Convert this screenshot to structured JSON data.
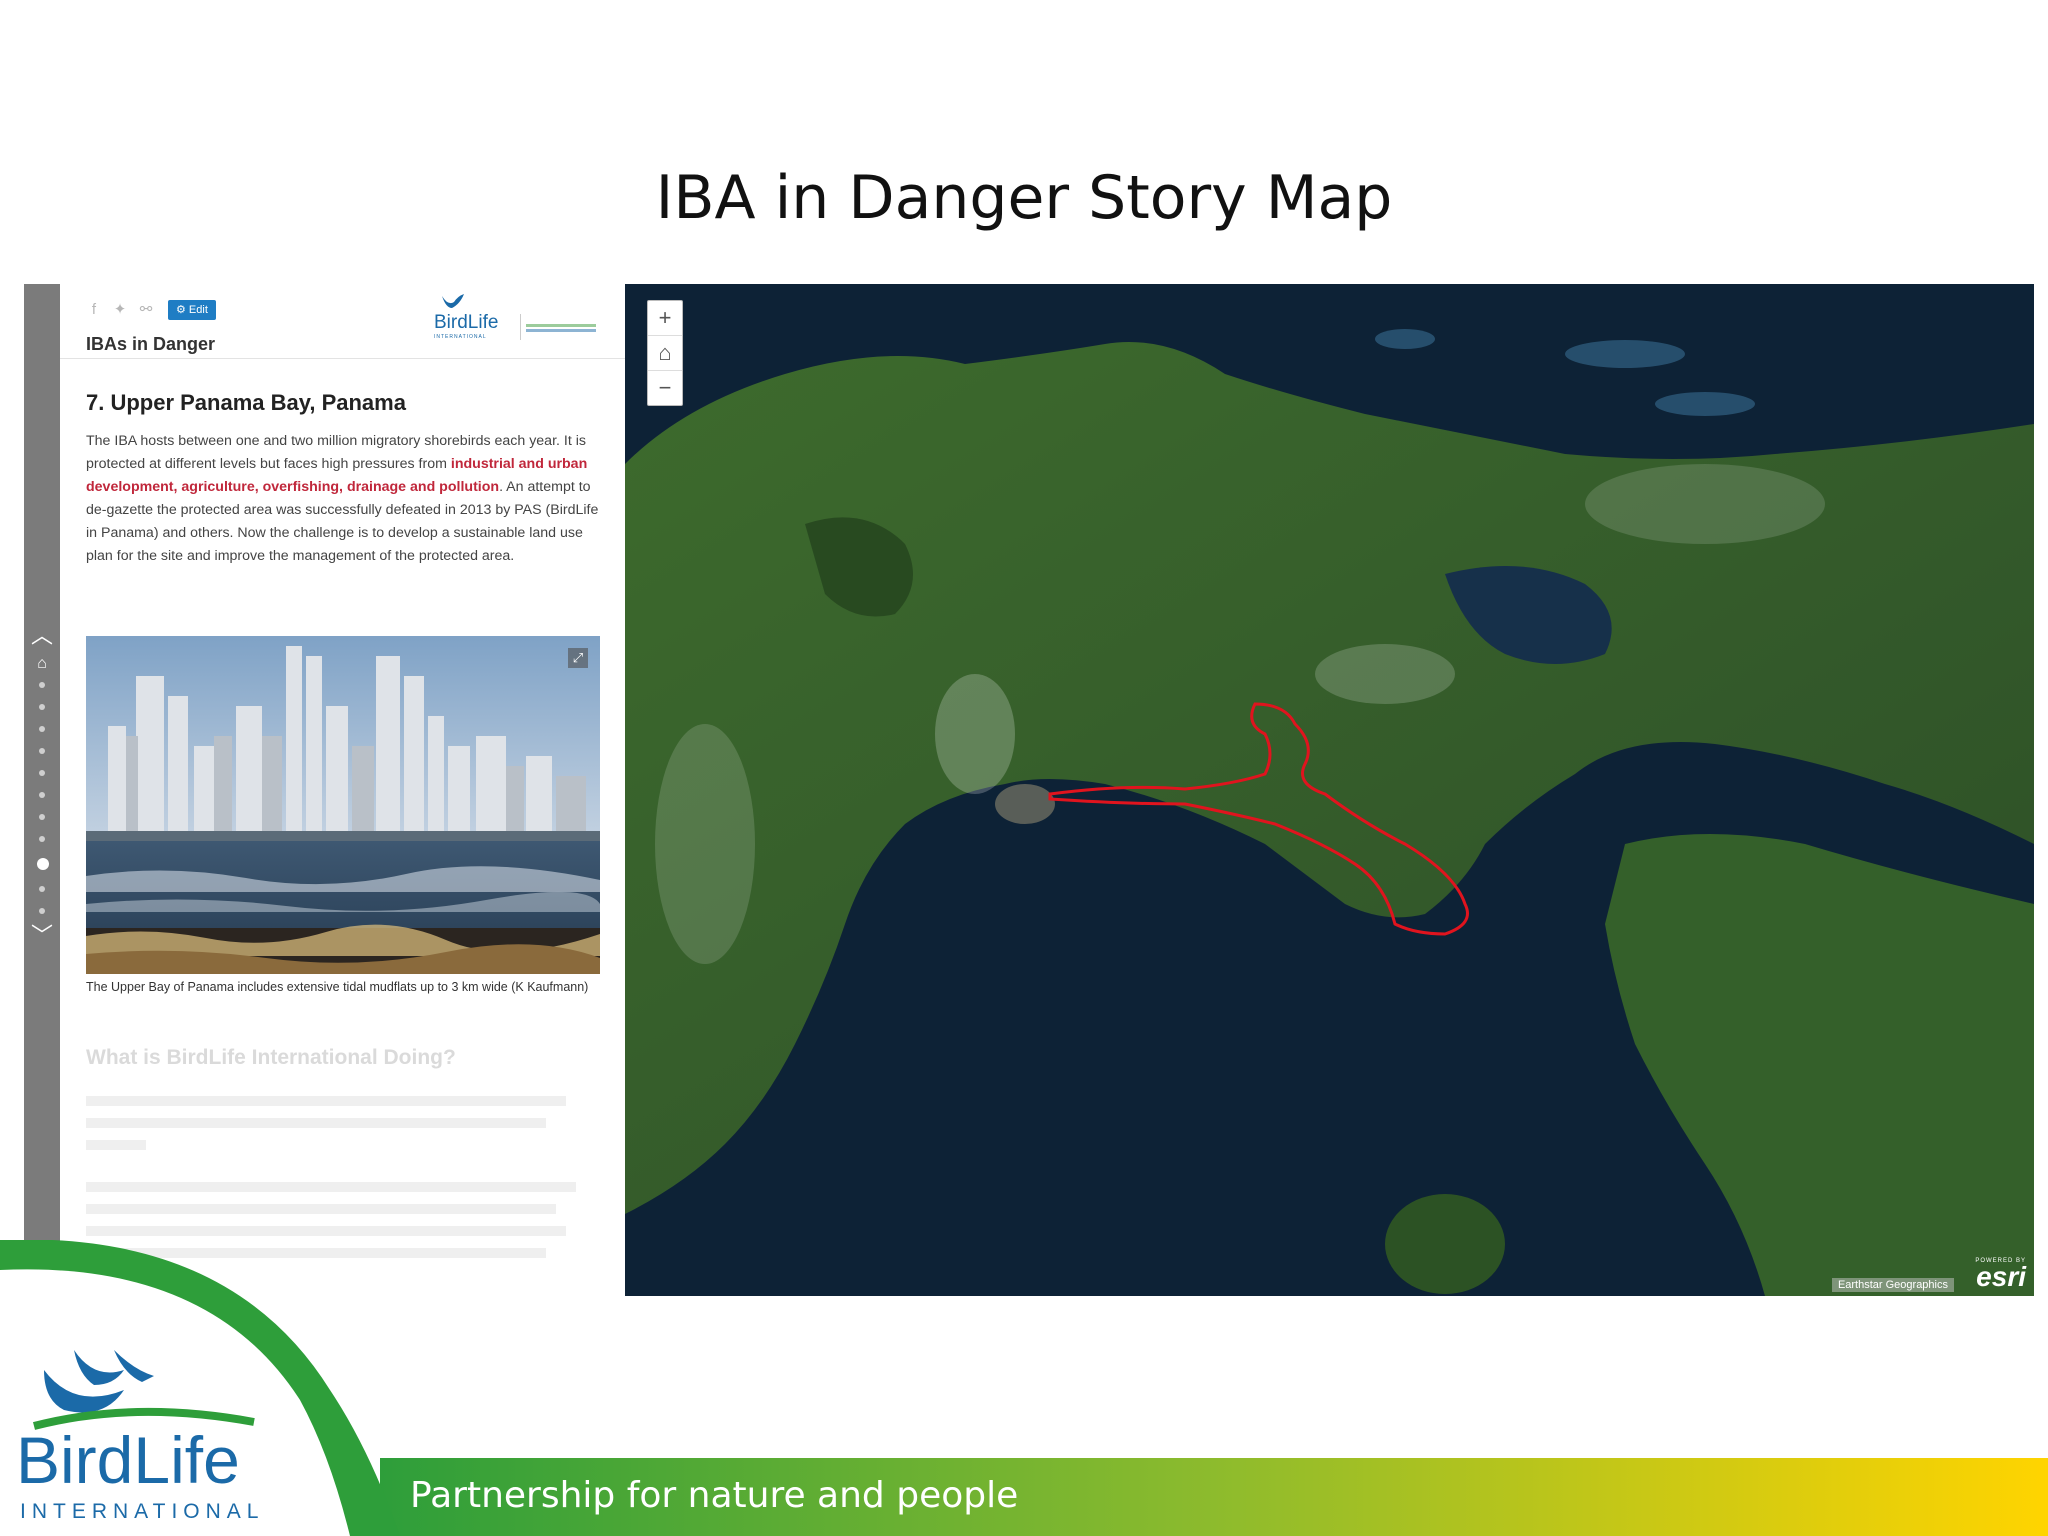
{
  "slide": {
    "title": "IBA in Danger Story Map",
    "tagline": "Partnership for nature and people",
    "logo": {
      "line1": "BirdLife",
      "line2": "INTERNATIONAL"
    },
    "colors": {
      "green": "#2e9e3a",
      "yellow": "#ffd400",
      "logo_blue": "#1b6aa8"
    }
  },
  "storymap": {
    "header": {
      "share_icons": [
        "facebook-icon",
        "twitter-icon",
        "link-icon"
      ],
      "edit_label": "Edit",
      "title": "IBAs in Danger",
      "logo_text": "BirdLife",
      "logo_small": "INTERNATIONAL"
    },
    "section": {
      "heading": "7. Upper Panama Bay, Panama",
      "text_1": "The IBA hosts between one and two million migratory shorebirds each year. It is protected at different levels but faces high pressures from ",
      "text_highlight": "industrial and urban development, agriculture, overfishing, drainage and pollution",
      "text_2": ". An attempt to de-gazette the protected area was successfully defeated in 2013 by PAS (BirdLife in Panama) and others. Now the challenge is to develop a sustainable land use plan for the site and improve the management of the protected area.",
      "caption": "The Upper Bay of Panama includes extensive tidal mudflats up to 3 km wide (K Kaufmann)"
    },
    "next_section": {
      "heading": "What is BirdLife International Doing?"
    },
    "map": {
      "zoom_in": "+",
      "home": "⌂",
      "zoom_out": "−",
      "attribution": "Earthstar Geographics",
      "powered_by": "POWERED BY",
      "esri": "esri"
    },
    "rail": {
      "total_items": 11,
      "active_index": 9
    }
  }
}
